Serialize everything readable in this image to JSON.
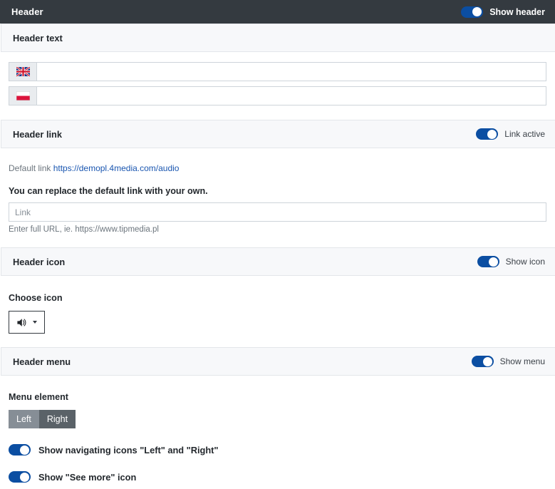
{
  "topbar": {
    "title": "Header",
    "toggle_label": "Show header",
    "toggle_on": true
  },
  "sections": {
    "header_text": {
      "title": "Header text",
      "fields": [
        {
          "flag": "flag-uk-icon",
          "flag_name": "United Kingdom",
          "value": "",
          "placeholder": ""
        },
        {
          "flag": "flag-pl-icon",
          "flag_name": "Poland",
          "value": "",
          "placeholder": ""
        }
      ]
    },
    "header_link": {
      "title": "Header link",
      "toggle_label": "Link active",
      "toggle_on": true,
      "default_link_prefix": "Default link",
      "default_link_url": "https://demopl.4media.com/audio",
      "replace_text": "You can replace the default link with your own.",
      "link_placeholder": "Link",
      "link_value": "",
      "helper_text": "Enter full URL, ie. https://www.tipmedia.pl"
    },
    "header_icon": {
      "title": "Header icon",
      "toggle_label": "Show icon",
      "toggle_on": true,
      "choose_label": "Choose icon",
      "selected_icon": "speaker-volume-icon"
    },
    "header_menu": {
      "title": "Header menu",
      "toggle_label": "Show menu",
      "toggle_on": true,
      "menu_element_label": "Menu element",
      "buttons": [
        {
          "label": "Left",
          "selected": false
        },
        {
          "label": "Right",
          "selected": true
        }
      ],
      "options": [
        {
          "label": "Show navigating icons \"Left\" and \"Right\"",
          "toggle_on": true
        },
        {
          "label": "Show \"See more\" icon",
          "toggle_on": true
        }
      ]
    }
  },
  "colors": {
    "topbar_bg": "#343a40",
    "toggle_on": "#0b4ea2",
    "link_blue": "#1a56b0",
    "section_bg": "#f7f8fa",
    "btn_inactive": "#868e96",
    "btn_active": "#5a6268"
  }
}
